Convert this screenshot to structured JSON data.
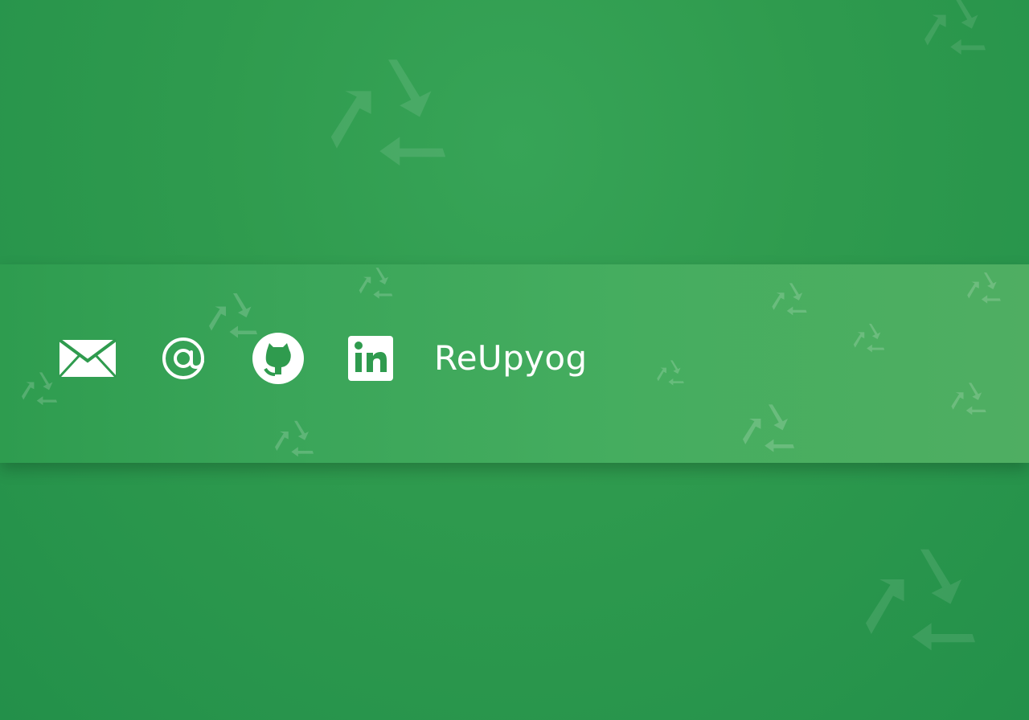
{
  "footer": {
    "brand_name": "ReUpyog",
    "icons": {
      "email": "email-icon",
      "at_sign": "at-sign-icon",
      "github": "github-icon",
      "linkedin": "linkedin-icon"
    }
  },
  "colors": {
    "background": "#2f9b4e",
    "band": "#45ad5f",
    "icon_color": "#ffffff",
    "text_color": "#ffffff"
  }
}
